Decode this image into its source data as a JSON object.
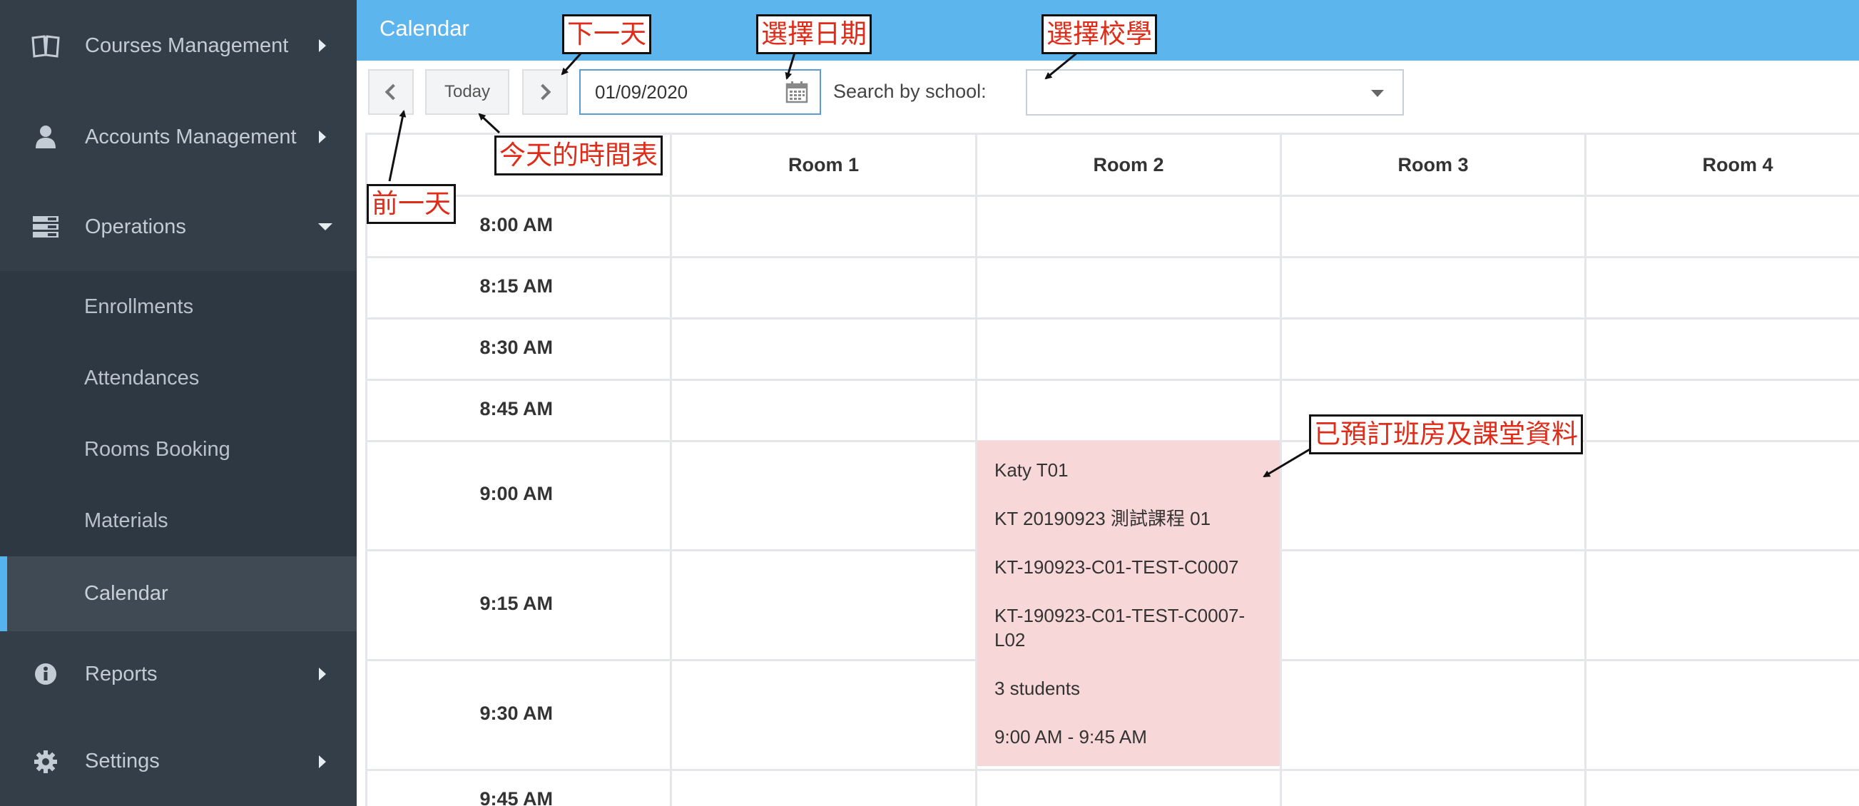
{
  "sidebar": {
    "courses": {
      "label": "Courses Management",
      "icon": "book-icon"
    },
    "accounts": {
      "label": "Accounts Management",
      "icon": "user-icon"
    },
    "operations": {
      "label": "Operations",
      "icon": "operations-icon",
      "items": [
        {
          "label": "Enrollments"
        },
        {
          "label": "Attendances"
        },
        {
          "label": "Rooms Booking"
        },
        {
          "label": "Materials"
        },
        {
          "label": "Calendar",
          "active": true
        }
      ]
    },
    "reports": {
      "label": "Reports",
      "icon": "info-icon"
    },
    "settings": {
      "label": "Settings",
      "icon": "gear-icon"
    }
  },
  "header": {
    "title": "Calendar"
  },
  "toolbar": {
    "today_label": "Today",
    "date_value": "01/09/2020",
    "search_label": "Search by school:",
    "school_value": ""
  },
  "grid": {
    "rooms": [
      "Room 1",
      "Room 2",
      "Room 3",
      "Room 4"
    ],
    "times": [
      "8:00 AM",
      "8:15 AM",
      "8:30 AM",
      "8:45 AM",
      "9:00 AM",
      "9:15 AM",
      "9:30 AM",
      "9:45 AM"
    ]
  },
  "booking": {
    "teacher": "Katy T01",
    "course": "KT 20190923 測試課程 01",
    "class_code": "KT-190923-C01-TEST-C0007",
    "lesson_code": "KT-190923-C01-TEST-C0007-L02",
    "students": "3 students",
    "time_range": "9:00 AM - 9:45 AM"
  },
  "annotations": {
    "next_day": "下一天",
    "select_date": "選擇日期",
    "select_school": "選擇校學",
    "today_schedule": "今天的時間表",
    "prev_day": "前一天",
    "booked": "已預訂班房及課堂資料"
  },
  "colors": {
    "sidebar_bg": "#333e48",
    "header_bg": "#5db5ee",
    "active_accent": "#55b4ef",
    "booking_bg": "#f7d7d7",
    "annotation_text": "#e02b18"
  }
}
